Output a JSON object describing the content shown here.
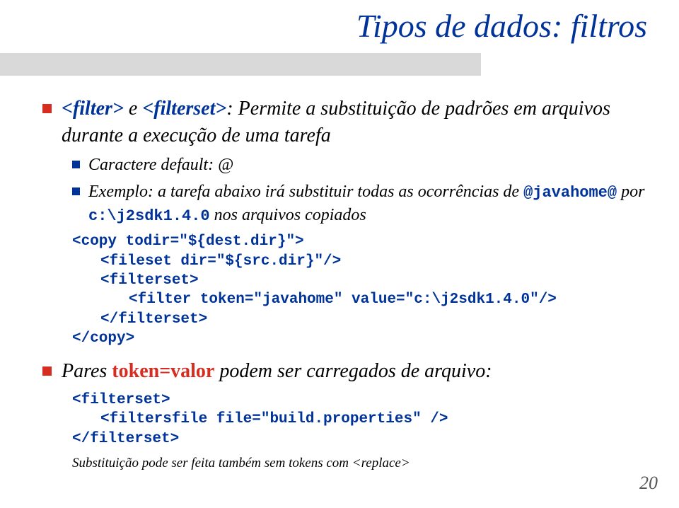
{
  "title": "Tipos de dados: filtros",
  "bullet1_a": "<filter>",
  "bullet1_b": " e ",
  "bullet1_c": "<filterset>",
  "bullet1_d": ": Permite a substituição de padrões em arquivos durante a execução de uma tarefa",
  "sub1": "Caractere default: @",
  "sub2_a": "Exemplo: a tarefa abaixo irá substituir todas as ocorrências de ",
  "sub2_b": "@javahome@",
  "sub2_c": " por ",
  "sub2_d": "c:\\j2sdk1.4.0",
  "sub2_e": " nos arquivos copiados",
  "code1_l1": "<copy todir=\"${dest.dir}\">",
  "code1_l2": "<fileset dir=\"${src.dir}\"/>",
  "code1_l3": "<filterset>",
  "code1_l4": "<filter token=\"javahome\" value=\"c:\\j2sdk1.4.0\"/>",
  "code1_l5": "</filterset>",
  "code1_l6": "</copy>",
  "bullet2_a": "Pares ",
  "bullet2_b": "token=valor",
  "bullet2_c": " podem ser carregados de arquivo:",
  "code2_l1": "<filterset>",
  "code2_l2": "<filtersfile file=\"build.properties\" />",
  "code2_l3": "</filterset>",
  "footer": "Substituição pode ser feita também sem tokens com <replace>",
  "page": "20"
}
